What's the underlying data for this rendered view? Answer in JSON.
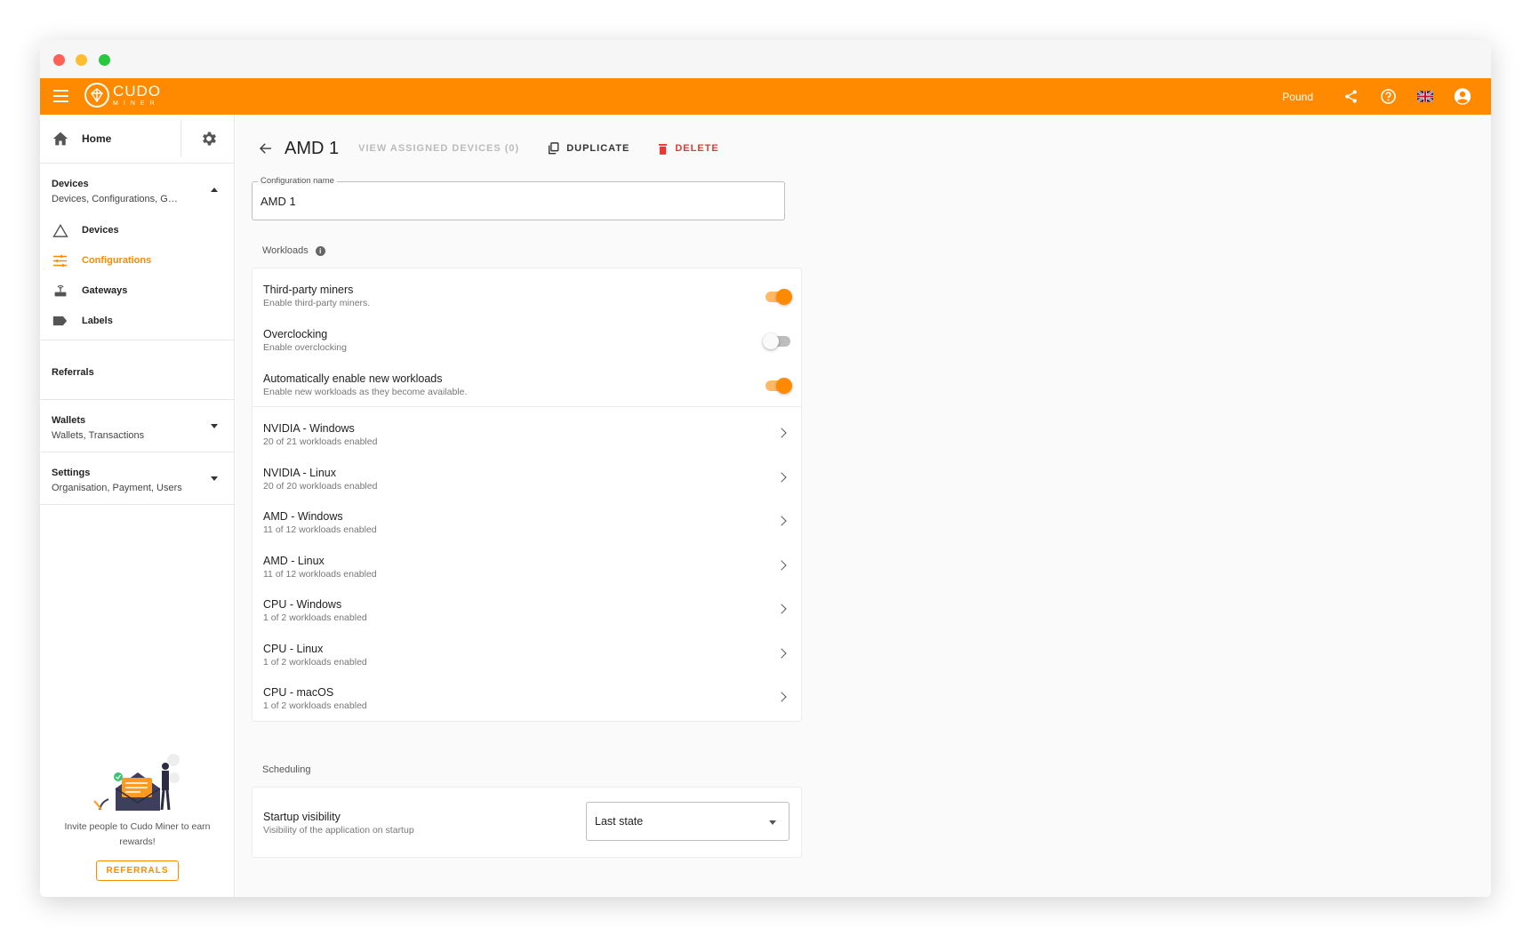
{
  "brand": {
    "name": "CUDO",
    "tagline": "MINER",
    "accent": "#ff8a00"
  },
  "topbar": {
    "currency": "Pound"
  },
  "sidebar": {
    "home_label": "Home",
    "devices_group": {
      "title": "Devices",
      "subtitle": "Devices, Configurations, Gat...",
      "items": [
        {
          "label": "Devices"
        },
        {
          "label": "Configurations"
        },
        {
          "label": "Gateways"
        },
        {
          "label": "Labels"
        }
      ]
    },
    "referrals_label": "Referrals",
    "wallets_group": {
      "title": "Wallets",
      "subtitle": "Wallets, Transactions"
    },
    "settings_group": {
      "title": "Settings",
      "subtitle": "Organisation, Payment, Users"
    },
    "invite_text": "Invite people to Cudo Miner to earn rewards!",
    "referrals_button": "REFERRALS"
  },
  "page": {
    "title": "AMD 1",
    "view_assigned": "VIEW ASSIGNED DEVICES (0)",
    "duplicate": "DUPLICATE",
    "delete": "DELETE",
    "config_name_label": "Configuration name",
    "config_name_value": "AMD 1",
    "workloads_label": "Workloads",
    "toggles": [
      {
        "title": "Third-party miners",
        "sub": "Enable third-party miners.",
        "on": true
      },
      {
        "title": "Overclocking",
        "sub": "Enable overclocking",
        "on": false
      },
      {
        "title": "Automatically enable new workloads",
        "sub": "Enable new workloads as they become available.",
        "on": true
      }
    ],
    "platforms": [
      {
        "title": "NVIDIA - Windows",
        "sub": "20 of 21 workloads enabled"
      },
      {
        "title": "NVIDIA - Linux",
        "sub": "20 of 20 workloads enabled"
      },
      {
        "title": "AMD - Windows",
        "sub": "11 of 12 workloads enabled"
      },
      {
        "title": "AMD - Linux",
        "sub": "11 of 12 workloads enabled"
      },
      {
        "title": "CPU - Windows",
        "sub": "1 of 2 workloads enabled"
      },
      {
        "title": "CPU - Linux",
        "sub": "1 of 2 workloads enabled"
      },
      {
        "title": "CPU - macOS",
        "sub": "1 of 2 workloads enabled"
      }
    ],
    "scheduling_label": "Scheduling",
    "startup": {
      "title": "Startup visibility",
      "sub": "Visibility of the application on startup",
      "value": "Last state"
    }
  }
}
